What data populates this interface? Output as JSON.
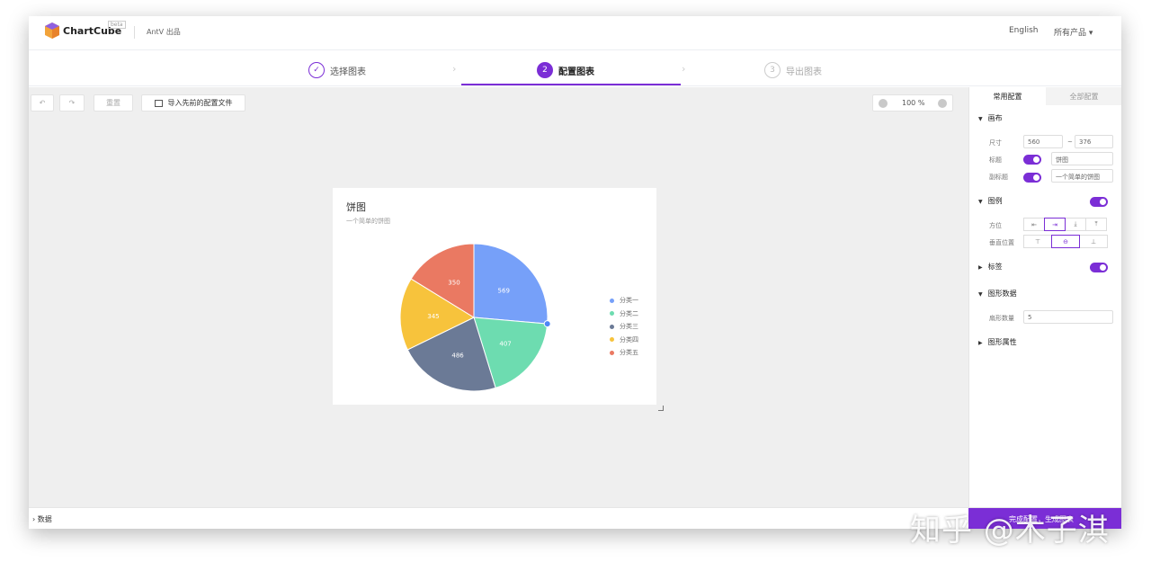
{
  "header": {
    "brand": "ChartCube",
    "beta_badge": "beta",
    "vendor": "AntV 出品",
    "language": "English",
    "products_menu": "所有产品 ▾"
  },
  "steps": [
    {
      "num": "✓",
      "label": "选择图表"
    },
    {
      "num": "2",
      "label": "配置图表"
    },
    {
      "num": "3",
      "label": "导出图表"
    }
  ],
  "toolbar": {
    "undo_icon": "↶",
    "redo_icon": "↷",
    "reset_label": "重置",
    "import_label": "导入先前的配置文件",
    "zoom": "100 %"
  },
  "chart_data": {
    "type": "pie",
    "title": "饼图",
    "subtitle": "一个简单的饼图",
    "categories": [
      "分类一",
      "分类二",
      "分类三",
      "分类四",
      "分类五"
    ],
    "values": [
      569,
      407,
      486,
      345,
      350
    ],
    "colors": [
      "#76a0f9",
      "#6ddcb0",
      "#6b7a96",
      "#f7c33c",
      "#ea7962"
    ],
    "legend": "right",
    "labels": "inside"
  },
  "panel": {
    "tab_common": "常用配置",
    "tab_all": "全部配置",
    "canvas_section": "画布",
    "size_label": "尺寸",
    "width": "560",
    "size_sep": "~",
    "height": "376",
    "title_label": "标题",
    "title_value": "饼图",
    "subtitle_label": "副标题",
    "subtitle_value": "一个简单的饼图",
    "legend_section": "图例",
    "position_label": "方位",
    "vertical_label": "垂直位置",
    "label_section": "标签",
    "shape_data_section": "图形数据",
    "sector_count_label": "扇形数量",
    "sector_count": "5",
    "shape_props_section": "图形属性"
  },
  "bottom": {
    "data_label": "› 数据",
    "generate_label": "完成配置，生成图表"
  },
  "watermark": "知乎 @木子淇"
}
